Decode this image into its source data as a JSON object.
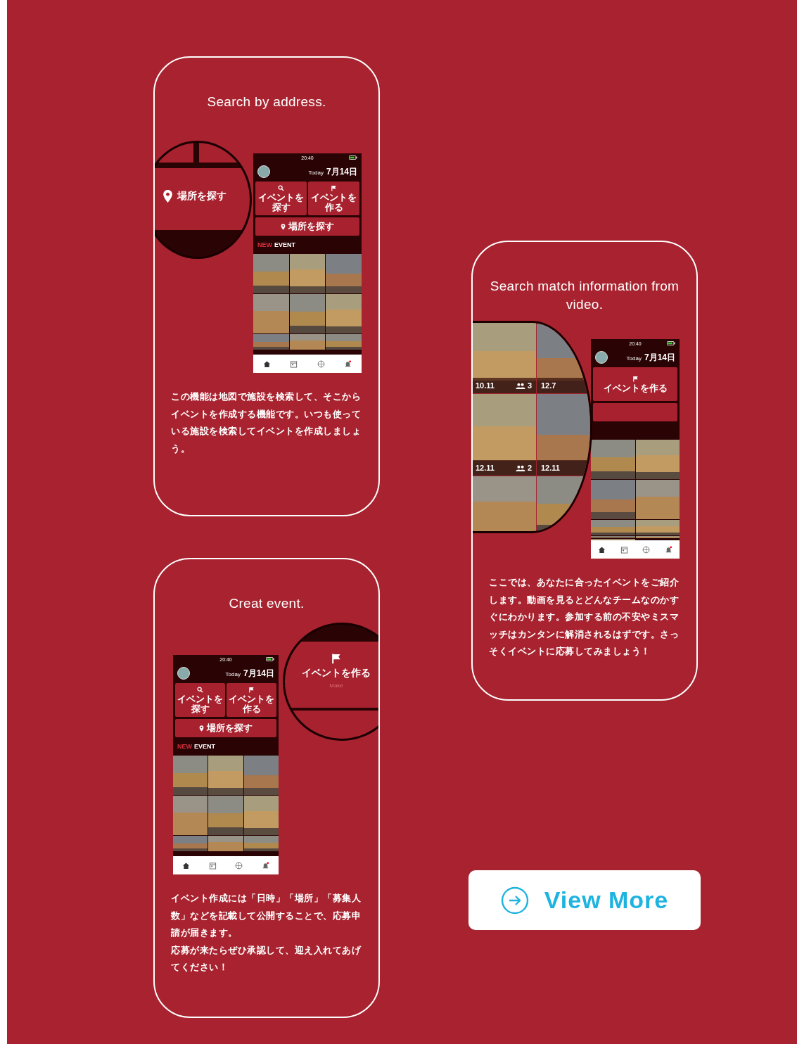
{
  "cards": [
    {
      "title": "Search by address.",
      "phone": {
        "time": "20:40",
        "today": "Today",
        "date": "7月14日",
        "buttons": [
          {
            "kind": "search",
            "label": "イベントを探す"
          },
          {
            "kind": "make",
            "label": "イベントを作る"
          }
        ],
        "place_button": "場所を探す",
        "section_new": "NEW",
        "section_event": "EVENT"
      },
      "zoom": {
        "kind": "place",
        "label": "場所を探す"
      },
      "body": [
        "この機能は地図で施設を検索して、そこからイベントを作成する機能です。いつも使っている施設を検索してイベントを作成しましょう。"
      ]
    },
    {
      "title": "Creat event.",
      "phone": {
        "time": "20:40",
        "today": "Today",
        "date": "7月14日",
        "buttons": [
          {
            "kind": "search",
            "label": "イベントを探す"
          },
          {
            "kind": "make",
            "label": "イベントを作る"
          }
        ],
        "place_button": "場所を探す",
        "section_new": "NEW",
        "section_event": "EVENT"
      },
      "zoom": {
        "kind": "make",
        "label": "イベントを作る",
        "sub": "Make"
      },
      "body": [
        "イベント作成には「日時」「場所」「募集人数」などを記載して公開することで、応募申請が届きます。",
        "応募が来たらぜひ承認して、迎え入れてあげてください！"
      ]
    },
    {
      "title": "Search match information from video.",
      "phone": {
        "time": "20:40",
        "today": "Today",
        "date": "7月14日",
        "buttons": [
          {
            "kind": "make",
            "label": "イベントを作る"
          }
        ]
      },
      "zoom": {
        "kind": "video",
        "tiles": [
          {
            "date": "10.11",
            "count": "3"
          },
          {
            "date": "12.7"
          },
          {
            "date": "12.11",
            "count": "2"
          },
          {
            "date": "12.11"
          }
        ]
      },
      "body": [
        "ここでは、あなたに合ったイベントをご紹介します。動画を見るとどんなチームなのかすぐにわかります。参加する前の不安やミスマッチはカンタンに解消されるはずです。さっそくイベントに応募してみましょう！"
      ]
    }
  ],
  "view_more": {
    "label": "View More"
  }
}
